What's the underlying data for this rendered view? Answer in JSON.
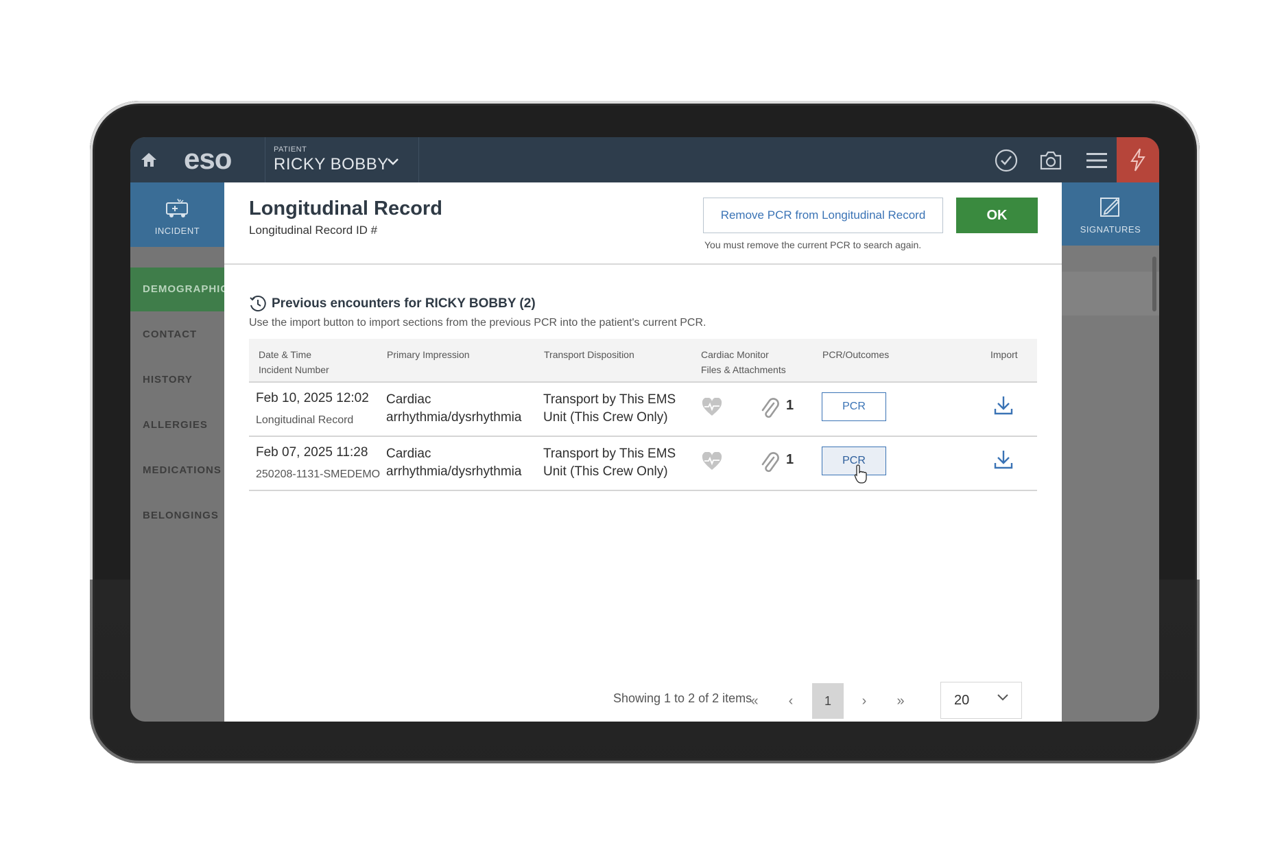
{
  "header": {
    "logo": "eso",
    "patient_label": "PATIENT",
    "patient_name": "RICKY BOBBY"
  },
  "sidebar": {
    "incident_label": "INCIDENT",
    "items": [
      {
        "label": "DEMOGRAPHIC",
        "active": true
      },
      {
        "label": "CONTACT"
      },
      {
        "label": "HISTORY"
      },
      {
        "label": "ALLERGIES"
      },
      {
        "label": "MEDICATIONS"
      },
      {
        "label": "BELONGINGS"
      }
    ]
  },
  "right_panel": {
    "signatures_label": "SIGNATURES"
  },
  "modal": {
    "title": "Longitudinal Record",
    "subtitle": "Longitudinal Record ID #",
    "remove_button": "Remove PCR from Longitudinal Record",
    "remove_note": "You must remove the current PCR to search again.",
    "ok_button": "OK",
    "section_title": "Previous encounters for RICKY BOBBY (2)",
    "section_help": "Use the import button to import sections from the previous PCR into the patient's current PCR.",
    "columns": {
      "date": "Date & Time",
      "incident": "Incident Number",
      "impression": "Primary Impression",
      "disposition": "Transport Disposition",
      "monitor": "Cardiac Monitor",
      "files": "Files & Attachments",
      "pcr": "PCR/Outcomes",
      "import": "Import"
    },
    "rows": [
      {
        "date": "Feb 10, 2025 12:02",
        "incident": "Longitudinal Record",
        "impression_1": "Cardiac",
        "impression_2": "arrhythmia/dysrhythmia",
        "disposition_1": "Transport by This EMS",
        "disposition_2": "Unit (This Crew Only)",
        "attachments": "1",
        "pcr_button": "PCR"
      },
      {
        "date": "Feb 07, 2025 11:28",
        "incident": "250208-1131-SMEDEMO",
        "impression_1": "Cardiac",
        "impression_2": "arrhythmia/dysrhythmia",
        "disposition_1": "Transport by This EMS",
        "disposition_2": "Unit (This Crew Only)",
        "attachments": "1",
        "pcr_button": "PCR"
      }
    ],
    "pager": {
      "showing": "Showing 1 to 2 of 2 items",
      "first": "«",
      "prev": "‹",
      "current_page": "1",
      "next": "›",
      "last": "»",
      "page_size": "20"
    }
  },
  "colors": {
    "topbar": "#2e3d4c",
    "ok_green": "#3a8a3f",
    "link_blue": "#3a73b5",
    "active_nav": "#3f7d4a",
    "alert_red": "#b6453a"
  }
}
